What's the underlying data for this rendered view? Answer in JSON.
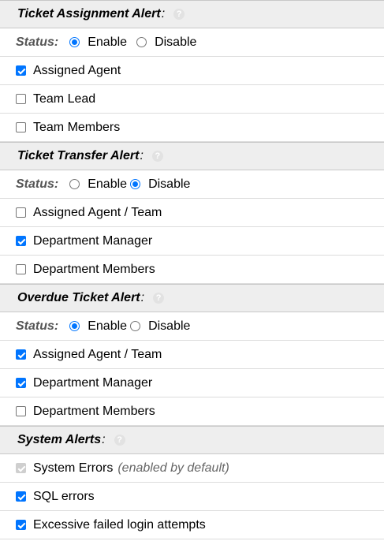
{
  "sections": [
    {
      "title": "Ticket Assignment Alert",
      "colon": ":",
      "help": "?",
      "status_label": "Status:",
      "enable_label": "Enable",
      "disable_label": "Disable",
      "status": "enable",
      "options": [
        {
          "label": "Assigned Agent",
          "checked": true
        },
        {
          "label": "Team Lead",
          "checked": false
        },
        {
          "label": "Team Members",
          "checked": false
        }
      ]
    },
    {
      "title": "Ticket Transfer Alert",
      "colon": ":",
      "help": "?",
      "status_label": "Status:",
      "enable_label": "Enable",
      "disable_label": "Disable",
      "status": "disable",
      "options": [
        {
          "label": "Assigned Agent / Team",
          "checked": false
        },
        {
          "label": "Department Manager",
          "checked": true
        },
        {
          "label": "Department Members",
          "checked": false
        }
      ]
    },
    {
      "title": "Overdue Ticket Alert",
      "colon": ":",
      "help": "?",
      "status_label": "Status:",
      "enable_label": "Enable",
      "disable_label": "Disable",
      "status": "enable",
      "options": [
        {
          "label": "Assigned Agent / Team",
          "checked": true
        },
        {
          "label": "Department Manager",
          "checked": true
        },
        {
          "label": "Department Members",
          "checked": false
        }
      ]
    }
  ],
  "system": {
    "title": "System Alerts",
    "colon": ":",
    "help": "?",
    "options": [
      {
        "label": "System Errors",
        "note": "(enabled by default)",
        "checked": true,
        "disabled": true
      },
      {
        "label": "SQL errors",
        "checked": true,
        "disabled": false
      },
      {
        "label": "Excessive failed login attempts",
        "checked": true,
        "disabled": false
      }
    ]
  },
  "colors": {
    "accent": "#0075ff",
    "header_bg": "#eeeeee",
    "status_label": "#555555"
  }
}
